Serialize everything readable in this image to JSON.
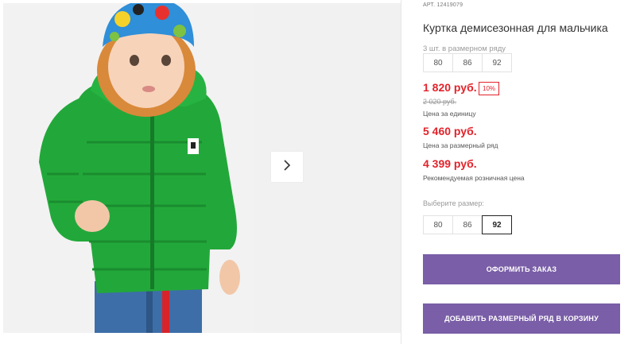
{
  "product": {
    "article_label": "АРТ.",
    "article": "12419079",
    "title": "Куртка демисезонная для мальчика"
  },
  "size_set": {
    "note": "3 шт. в размерном ряду",
    "sizes": [
      "80",
      "86",
      "92"
    ]
  },
  "pricing": {
    "unit_price": "1 820 руб.",
    "discount_badge": "10%",
    "old_price": "2 020 руб.",
    "unit_caption": "Цена за единицу",
    "set_price": "5 460 руб.",
    "set_caption": "Цена за размерный ряд",
    "retail_price": "4 399 руб.",
    "retail_caption": "Рекомендуемая розничная цена"
  },
  "size_select": {
    "label": "Выберите размер:",
    "options": [
      "80",
      "86",
      "92"
    ],
    "selected": "92"
  },
  "actions": {
    "order_label": "ОФОРМИТЬ ЗАКАЗ",
    "add_set_label": "ДОБАВИТЬ РАЗМЕРНЫЙ РЯД В КОРЗИНУ"
  },
  "colors": {
    "price_red": "#e2232b",
    "button_purple": "#7a5ea7",
    "jacket_green": "#1fa83a"
  },
  "icons": {
    "next": "chevron-right-icon"
  }
}
